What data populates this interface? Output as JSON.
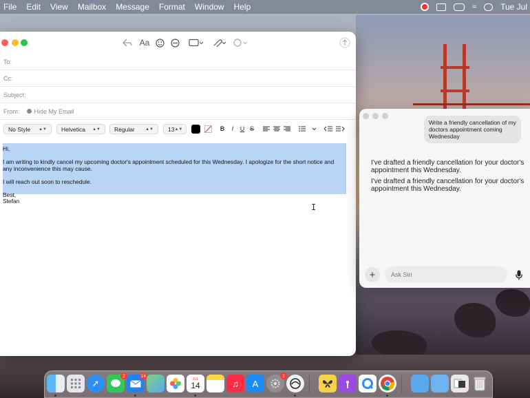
{
  "menubar": {
    "items": [
      "File",
      "Edit",
      "View",
      "Mailbox",
      "Message",
      "Format",
      "Window",
      "Help"
    ],
    "clock": "Tue Jul"
  },
  "mail": {
    "fields": {
      "to_label": "To:",
      "cc_label": "Cc:",
      "subject_label": "Subject:",
      "from_label": "From:",
      "from_value": "Hide My Email"
    },
    "format": {
      "style": "No Style",
      "font": "Helvetica",
      "weight": "Regular",
      "size": "13",
      "bold": "B",
      "italic": "I",
      "underline": "U",
      "strike": "S"
    },
    "body": {
      "greeting": "Hi,",
      "paragraph1": "I am writing to kindly cancel my upcoming doctor's appointment scheduled for this Wednesday. I apologize for the short notice and any inconvenience this may cause.",
      "paragraph2": "I will reach out soon to reschedule.",
      "signoff": "Best,",
      "name": "Stefan"
    }
  },
  "siri": {
    "user_bubble": "Write a friendly cancellation of my doctors appointment coming Wednesday",
    "reply1": "I've drafted a friendly cancellation for your doctor's appointment this Wednesday.",
    "reply2": "I've drafted a friendly cancellation for your doctor's appointment this Wednesday.",
    "input_placeholder": "Ask Siri"
  },
  "dock": {
    "messages_badge": "2",
    "mail_badge": "14",
    "calendar_month": "JUL",
    "calendar_day": "14",
    "settings_badge": "1"
  },
  "colors": {
    "selection": "#b9d5f6",
    "close": "#ff5f57",
    "minimize": "#febc2e",
    "zoom": "#28c840",
    "badge": "#ff3b30"
  }
}
